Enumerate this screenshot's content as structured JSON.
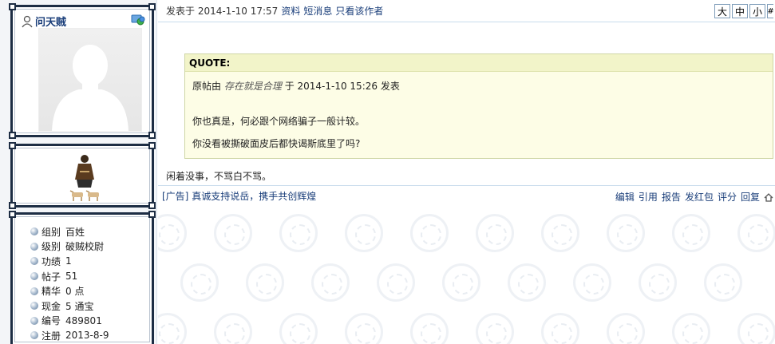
{
  "user": {
    "name": "问天贼"
  },
  "stats": [
    {
      "label": "组别",
      "value": "百姓"
    },
    {
      "label": "级别",
      "value": "破贼校尉"
    },
    {
      "label": "功绩",
      "value": "1"
    },
    {
      "label": "帖子",
      "value": "51"
    },
    {
      "label": "精华",
      "value": "0 点"
    },
    {
      "label": "现金",
      "value": "5 通宝"
    },
    {
      "label": "编号",
      "value": "489801"
    },
    {
      "label": "注册",
      "value": "2013-8-9"
    }
  ],
  "post": {
    "posted_text": "发表于 2014-1-10 17:57",
    "links": [
      "资料",
      "短消息",
      "只看该作者"
    ],
    "font_sizes": [
      "大",
      "中",
      "小"
    ],
    "font_cut": "#"
  },
  "quote": {
    "header": "QUOTE:",
    "orig_prefix": "原帖由",
    "orig_author": "存在就是合理",
    "orig_suffix": "于 2014-1-10 15:26 发表",
    "line1": "你也真是，何必跟个网络骗子一般计较。",
    "line2": "你没看被撕破面皮后都快谒斯底里了吗?"
  },
  "signature": "闲着没事，不骂白不骂。",
  "ad": {
    "tag": "[广告]",
    "text": "真诚支持说岳，携手共创辉煌"
  },
  "actions": [
    "编辑",
    "引用",
    "报告",
    "发红包",
    "评分",
    "回复"
  ],
  "colors": {
    "link": "#1a3e7a",
    "frame": "#1d2d44",
    "quote_bg": "#fdfde6",
    "quote_head_bg": "#f2f4c9"
  },
  "icons": [
    "user-icon",
    "msn-icon",
    "bullet-icon",
    "top-icon"
  ]
}
